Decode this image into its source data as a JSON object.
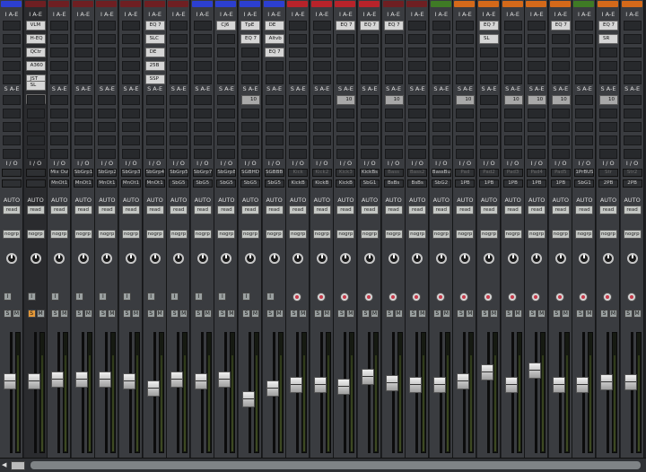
{
  "colors": {
    "red": "#b8232a",
    "blue": "#2c3fd0",
    "green": "#3f7a25",
    "orange": "#d4691a",
    "dark_red": "#6e1f22",
    "strip_bg": "#3a3c40"
  },
  "section_labels": {
    "inserts": "I A-E",
    "sends": "S A-E",
    "io": "I / O",
    "auto": "AUTO",
    "auto_mode": "read",
    "group": "nogrp",
    "solo": "S",
    "mute": "M",
    "input": "I"
  },
  "strips": [
    {
      "color": "blue",
      "inserts": [],
      "sends": [],
      "in": "",
      "out": "",
      "dim": false,
      "fader": 0.62,
      "solo_on": false
    },
    {
      "color": "dark_red",
      "inserts": [
        "VLM",
        "H-EQ",
        "QCtr",
        "A360",
        "JST",
        "SL",
        "Lmtl"
      ],
      "sends": [],
      "in": "",
      "out": "",
      "dim": true,
      "fader": 0.62,
      "solo_on": true
    },
    {
      "color": "dark_red",
      "inserts": [],
      "sends": [],
      "in": "Mix Out",
      "out": "MnOt1",
      "fader": 0.63,
      "solo_on": false
    },
    {
      "color": "dark_red",
      "inserts": [],
      "sends": [],
      "in": "SbGrp1",
      "out": "MnOt1",
      "fader": 0.63
    },
    {
      "color": "dark_red",
      "inserts": [],
      "sends": [],
      "in": "SbGrp2",
      "out": "MnOt1",
      "fader": 0.63
    },
    {
      "color": "dark_red",
      "inserts": [],
      "sends": [],
      "in": "SbGrp3",
      "out": "MnOt1",
      "fader": 0.62
    },
    {
      "color": "dark_red",
      "inserts": [
        "EQ 7",
        "SLC",
        "DE",
        "25B",
        "SSP"
      ],
      "sends": [],
      "in": "SbGrp4",
      "out": "MnOt1",
      "fader": 0.55
    },
    {
      "color": "dark_red",
      "inserts": [],
      "sends": [],
      "in": "SbGrp5",
      "out": "SbG5",
      "fader": 0.63
    },
    {
      "color": "blue",
      "inserts": [],
      "sends": [],
      "in": "SbGrp7",
      "out": "SbG5",
      "fader": 0.62
    },
    {
      "color": "blue",
      "inserts": [
        "CJ6"
      ],
      "sends": [],
      "in": "SbGrp8",
      "out": "SbG5",
      "fader": 0.63
    },
    {
      "color": "blue",
      "inserts": [
        "TpE",
        "EQ 7"
      ],
      "sends": [
        "10"
      ],
      "in": "SGBHD",
      "out": "SbG5",
      "fader": 0.45
    },
    {
      "color": "blue",
      "inserts": [
        "DE",
        "Altvb",
        "EQ 7"
      ],
      "sends": [],
      "in": "SGBBB",
      "out": "SbG5",
      "fader": 0.55
    },
    {
      "color": "red",
      "inserts": [],
      "sends": [],
      "in": "Kick",
      "out": "KickB",
      "fader": 0.58,
      "ioDim": true
    },
    {
      "color": "red",
      "inserts": [],
      "sends": [],
      "in": "Kick2",
      "out": "KickB",
      "fader": 0.58,
      "ioDim": true
    },
    {
      "color": "red",
      "inserts": [
        "EQ 7"
      ],
      "sends": [
        "10"
      ],
      "in": "Kick3",
      "out": "KickB",
      "fader": 0.57,
      "ioDim": true
    },
    {
      "color": "red",
      "inserts": [
        "EQ 7"
      ],
      "sends": [],
      "in": "KickBs",
      "out": "SbG1",
      "fader": 0.66
    },
    {
      "color": "dark_red",
      "inserts": [
        "EQ 7"
      ],
      "sends": [
        "10"
      ],
      "in": "Bass",
      "out": "BsBs",
      "fader": 0.6,
      "ioDim": true
    },
    {
      "color": "dark_red",
      "inserts": [],
      "sends": [],
      "in": "Bass2",
      "out": "BsBs",
      "fader": 0.58,
      "ioDim": true
    },
    {
      "color": "green",
      "inserts": [],
      "sends": [],
      "in": "BassBus",
      "out": "SbG2",
      "fader": 0.58
    },
    {
      "color": "orange",
      "inserts": [],
      "sends": [
        "10"
      ],
      "in": "Pad",
      "out": "1PB",
      "fader": 0.62,
      "ioDim": true
    },
    {
      "color": "orange",
      "inserts": [
        "EQ 7",
        "SL"
      ],
      "sends": [],
      "in": "Pad2",
      "out": "1PB",
      "fader": 0.7,
      "ioDim": true
    },
    {
      "color": "orange",
      "inserts": [],
      "sends": [
        "10"
      ],
      "in": "Pad3",
      "out": "1PB",
      "fader": 0.58,
      "ioDim": true
    },
    {
      "color": "orange",
      "inserts": [],
      "sends": [
        "10"
      ],
      "in": "Pad4",
      "out": "1PB",
      "fader": 0.72,
      "ioDim": true
    },
    {
      "color": "orange",
      "inserts": [
        "EQ 7"
      ],
      "sends": [
        "10"
      ],
      "in": "Pad5",
      "out": "1PB",
      "fader": 0.58,
      "ioDim": true
    },
    {
      "color": "green",
      "inserts": [],
      "sends": [],
      "in": "1PrBUS",
      "out": "SbG1",
      "fader": 0.58
    },
    {
      "color": "orange",
      "inserts": [
        "EQ 7",
        "SR"
      ],
      "sends": [
        "10"
      ],
      "in": "Str",
      "out": "2PB",
      "fader": 0.61,
      "ioDim": true
    },
    {
      "color": "orange",
      "inserts": [],
      "sends": [],
      "in": "Str2",
      "out": "2PB",
      "fader": 0.61,
      "ioDim": true
    }
  ]
}
